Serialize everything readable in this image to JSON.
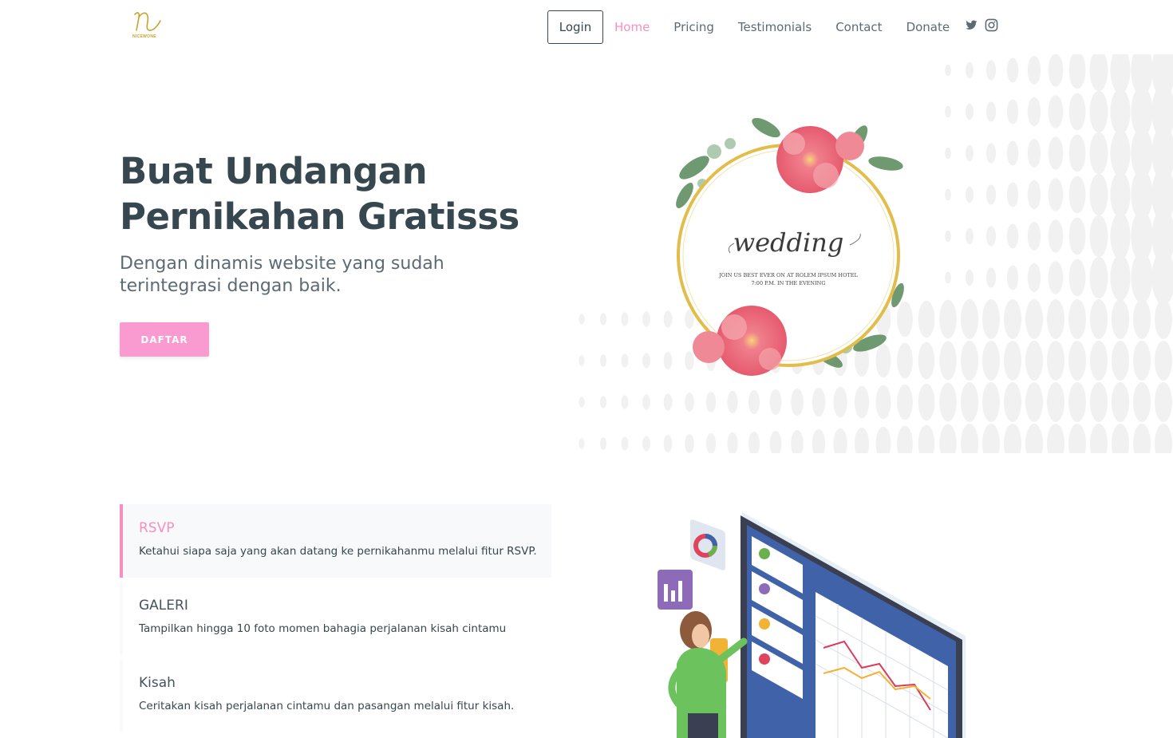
{
  "brand": {
    "logo_text": "NICEWONE"
  },
  "nav": {
    "login": "Login",
    "links": [
      "Home",
      "Pricing",
      "Testimonials",
      "Contact",
      "Donate"
    ],
    "active": "Home",
    "social_icons": [
      "twitter-icon",
      "instagram-icon"
    ]
  },
  "hero": {
    "title_line1": "Buat Undangan",
    "title_line2": "Pernikahan Gratisss",
    "subtitle": "Dengan dinamis website yang sudah terintegrasi dengan baik.",
    "cta": "DAFTAR",
    "card": {
      "script": "wedding",
      "line1": "JOIN US BEST EVER ON AT ROLEM IPSUM HOTEL",
      "line2": "7:00 P.M. IN THE EVENING"
    }
  },
  "features": [
    {
      "title": "RSVP",
      "desc": "Ketahui siapa saja yang akan datang ke pernikahanmu melalui fitur RSVP."
    },
    {
      "title": "GALERI",
      "desc": "Tampilkan hingga 10 foto momen bahagia perjalanan kisah cintamu"
    },
    {
      "title": "Kisah",
      "desc": "Ceritakan kisah perjalanan cintamu dan pasangan melalui fitur kisah."
    }
  ],
  "colors": {
    "accent": "#f78fbf",
    "text": "#37474f",
    "muted": "#5c6b73"
  }
}
